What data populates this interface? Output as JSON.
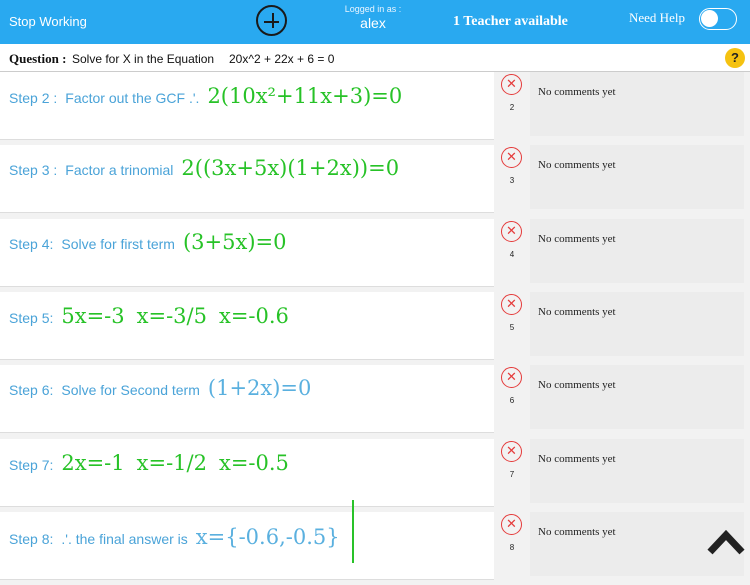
{
  "topbar": {
    "stop_label": "Stop Working",
    "add_icon": "plus-circle-icon",
    "logged_in_label": "Logged in as :",
    "username": "alex",
    "teacher_status": "1 Teacher available",
    "need_help_label": "Need Help",
    "need_help_on": false
  },
  "question": {
    "label": "Question :",
    "text": "Solve for X in the Equation",
    "equation": "20x^2 + 22x + 6 = 0",
    "help_icon": "?"
  },
  "colors": {
    "topbar": "#29a9f0",
    "math_green": "#27c227",
    "math_blue": "#5ab0df",
    "delete_red": "#e53b3b",
    "help_yellow": "#f5c211"
  },
  "steps": [
    {
      "label": "Step 2 :",
      "desc": "Factor out the GCF  .'.",
      "math": [
        "2(10x²+11x+3)=0"
      ],
      "math_color": "green",
      "number": "2",
      "comment": "No comments yet"
    },
    {
      "label": "Step 3 :",
      "desc": "Factor a trinomial",
      "math": [
        "2((3x+5x)(1+2x))=0"
      ],
      "math_color": "green",
      "number": "3",
      "comment": "No comments yet"
    },
    {
      "label": "Step 4:",
      "desc": "Solve for first term",
      "math": [
        "(3+5x)=0"
      ],
      "math_color": "green",
      "number": "4",
      "comment": "No comments yet"
    },
    {
      "label": "Step 5:",
      "desc": "",
      "math": [
        "5x=-3",
        "x=-3/5",
        "x=-0.6"
      ],
      "math_color": "green",
      "number": "5",
      "comment": "No comments yet"
    },
    {
      "label": "Step 6:",
      "desc": "Solve for Second term",
      "math": [
        "(1+2x)=0"
      ],
      "math_color": "blue",
      "number": "6",
      "comment": "No comments yet"
    },
    {
      "label": "Step 7:",
      "desc": "",
      "math": [
        "2x=-1",
        "x=-1/2",
        "x=-0.5"
      ],
      "math_color": "green",
      "number": "7",
      "comment": "No comments yet"
    },
    {
      "label": "Step 8:",
      "desc": ".'. the final answer is",
      "math": [
        "x={-0.6,-0.5}"
      ],
      "math_color": "blue",
      "number": "8",
      "comment": "No comments yet"
    }
  ],
  "scroll_icon": "chevron-up-icon"
}
